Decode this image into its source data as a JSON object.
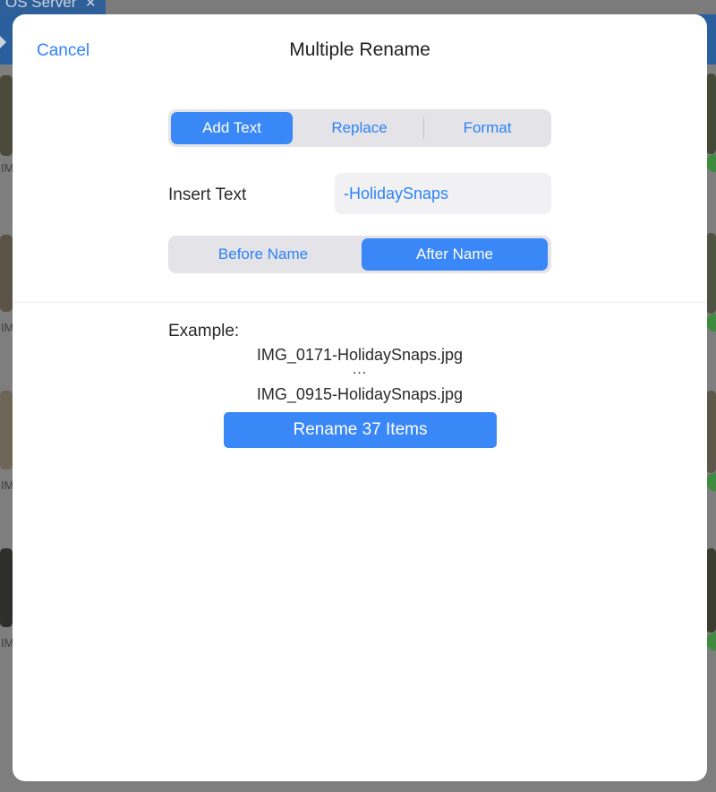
{
  "background_app": {
    "tab_title": "OS Server",
    "thumb_labels": [
      "IMG",
      "IM",
      "IM",
      "IMG"
    ]
  },
  "dialog": {
    "title": "Multiple Rename",
    "cancel_label": "Cancel"
  },
  "mode_tabs": [
    {
      "label": "Add Text",
      "selected": true
    },
    {
      "label": "Replace",
      "selected": false
    },
    {
      "label": "Format",
      "selected": false
    }
  ],
  "insert_text": {
    "label": "Insert Text",
    "value": "-HolidaySnaps"
  },
  "position_tabs": [
    {
      "label": "Before Name",
      "selected": false
    },
    {
      "label": "After Name",
      "selected": true
    }
  ],
  "example": {
    "label": "Example:",
    "first": "IMG_0171-HolidaySnaps.jpg",
    "ellipsis": "...",
    "last": "IMG_0915-HolidaySnaps.jpg"
  },
  "rename_button_label": "Rename 37 Items",
  "colors": {
    "accent": "#3a87f7",
    "link": "#2e83f6",
    "segment_bg": "#e3e3e8"
  }
}
